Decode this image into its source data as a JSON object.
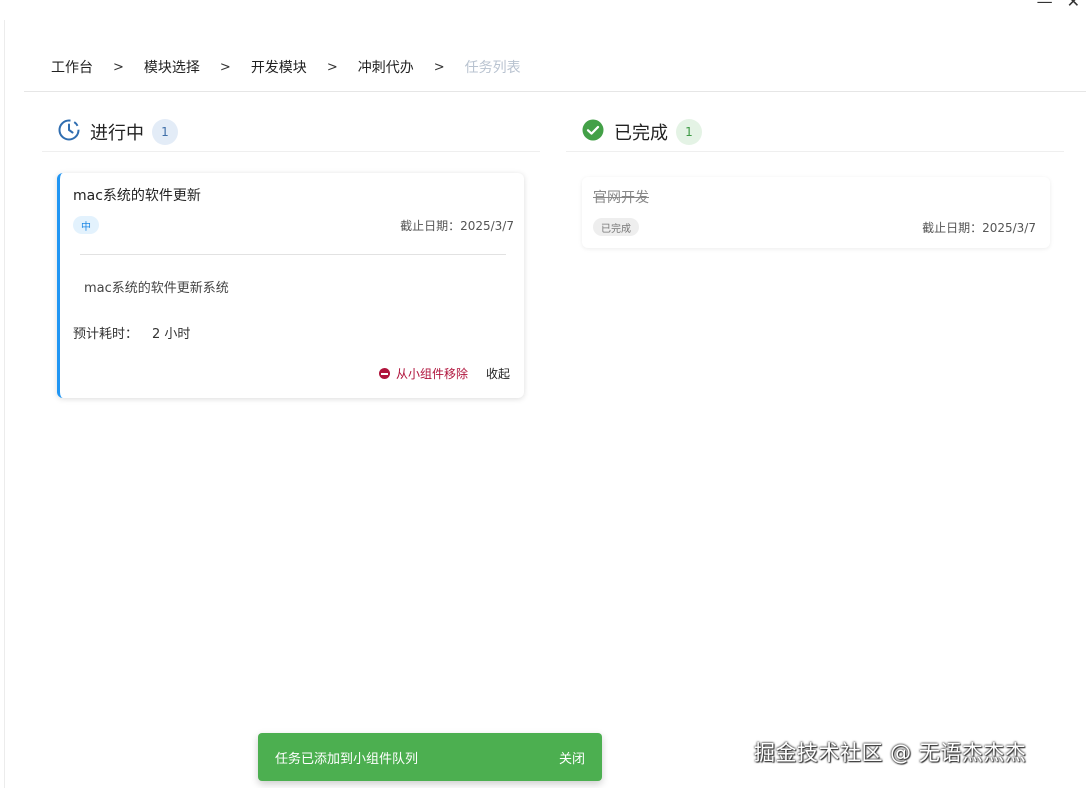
{
  "window": {
    "minimize_glyph": "—",
    "close_glyph": "✕"
  },
  "breadcrumb": {
    "separator": ">",
    "items": [
      "工作台",
      "模块选择",
      "开发模块",
      "冲刺代办"
    ],
    "current": "任务列表"
  },
  "columns": {
    "in_progress": {
      "title": "进行中",
      "count": "1",
      "icon": "clock-icon",
      "accent": "#2f6db0"
    },
    "completed": {
      "title": "已完成",
      "count": "1",
      "icon": "check-circle-icon",
      "accent": "#43a047"
    }
  },
  "in_progress_card": {
    "title": "mac系统的软件更新",
    "priority": "中",
    "due": "截止日期：2025/3/7",
    "description": "mac系统的软件更新系统",
    "estimate_label": "预计耗时：",
    "estimate_value": "2 小时",
    "remove_label": "从小组件移除",
    "collapse_label": "收起",
    "accent": "#2196f3"
  },
  "completed_card": {
    "title": "官网开发",
    "status": "已完成",
    "due": "截止日期：2025/3/7"
  },
  "snackbar": {
    "message": "任务已添加到小组件队列",
    "action": "关闭",
    "color": "#4caf50"
  },
  "watermark": "掘金技术社区 @ 无语杰杰杰"
}
